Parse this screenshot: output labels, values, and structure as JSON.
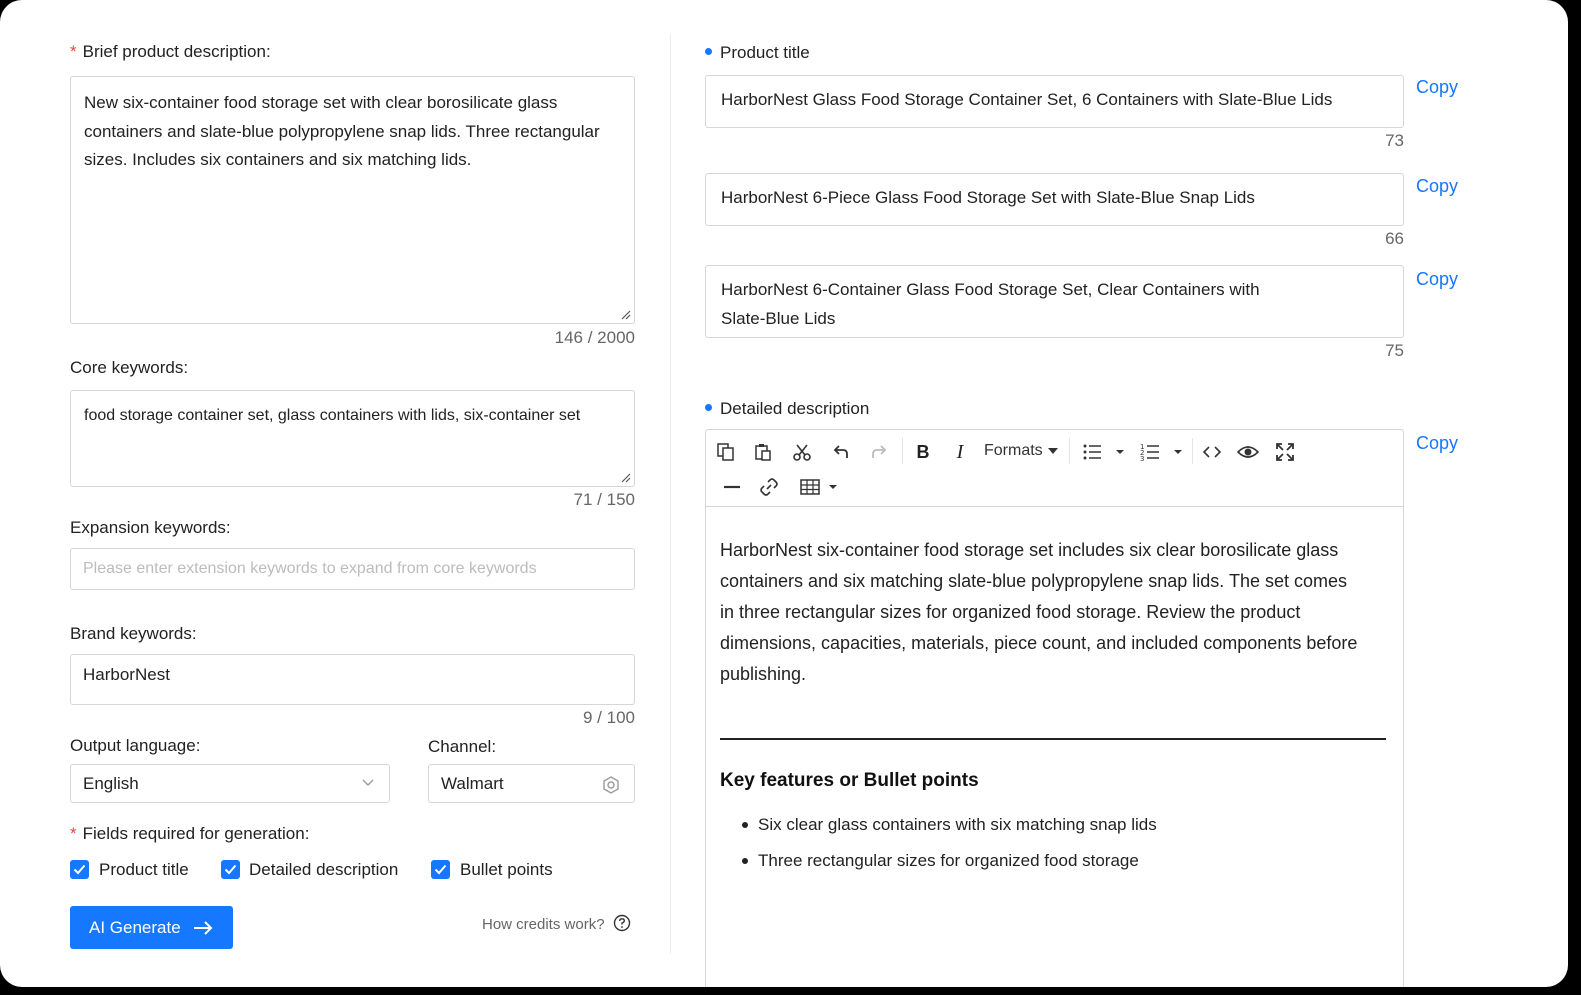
{
  "left": {
    "brief": {
      "label": "Brief product description:",
      "value": "New six-container food storage set with clear borosilicate glass containers and slate-blue polypropylene snap lids. Three rectangular sizes. Includes six containers and six matching lids.",
      "counter": "146 / 2000"
    },
    "core": {
      "label": "Core keywords:",
      "value": "food storage container set, glass containers with lids, six-container set",
      "counter": "71 / 150"
    },
    "expansion": {
      "label": "Expansion keywords:",
      "placeholder": "Please enter extension keywords to expand from core keywords"
    },
    "brand": {
      "label": "Brand keywords:",
      "value": "HarborNest",
      "counter": "9 / 100"
    },
    "output_language": {
      "label": "Output language:",
      "value": "English"
    },
    "channel": {
      "label": "Channel:",
      "value": "Walmart"
    },
    "fields": {
      "label": "Fields required for generation:",
      "options": [
        {
          "label": "Product title",
          "checked": true
        },
        {
          "label": "Detailed description",
          "checked": true
        },
        {
          "label": "Bullet points",
          "checked": true
        }
      ]
    },
    "generate_label": "AI Generate",
    "credits_label": "How credits work?"
  },
  "right": {
    "product_title_label": "Product title",
    "titles": [
      {
        "text": "HarborNest Glass Food Storage Container Set, 6 Containers with Slate-Blue Lids",
        "count": "73"
      },
      {
        "text": "HarborNest 6-Piece Glass Food Storage Set with Slate-Blue Snap Lids",
        "count": "66"
      },
      {
        "text": "HarborNest 6-Container Glass Food Storage Set, Clear Containers with Slate-Blue Lids",
        "count": "75"
      }
    ],
    "copy_label": "Copy",
    "detailed_label": "Detailed description",
    "toolbar": {
      "formats_label": "Formats"
    },
    "description": "HarborNest six-container food storage set includes six clear borosilicate glass containers and six matching slate-blue polypropylene snap lids. The set comes in three rectangular sizes for organized food storage. Review the product dimensions, capacities, materials, piece count, and included components before publishing.",
    "key_features_heading": "Key features or Bullet points",
    "bullets": [
      "Six clear glass containers with six matching snap lids",
      "Three rectangular sizes for organized food storage"
    ]
  },
  "colors": {
    "accent": "#1677ff",
    "required": "#f0433a",
    "border": "#d6d6d6"
  },
  "icons": [
    "resize-handle-icon",
    "chevron-down-icon",
    "settings-icon",
    "check-icon",
    "arrow-right-icon",
    "help-circle-icon",
    "copy-icon",
    "paste-icon",
    "cut-icon",
    "undo-icon",
    "redo-icon",
    "bold-icon",
    "italic-icon",
    "unordered-list-icon",
    "ordered-list-icon",
    "code-icon",
    "preview-icon",
    "fullscreen-icon",
    "horizontal-rule-icon",
    "link-icon",
    "table-icon"
  ]
}
